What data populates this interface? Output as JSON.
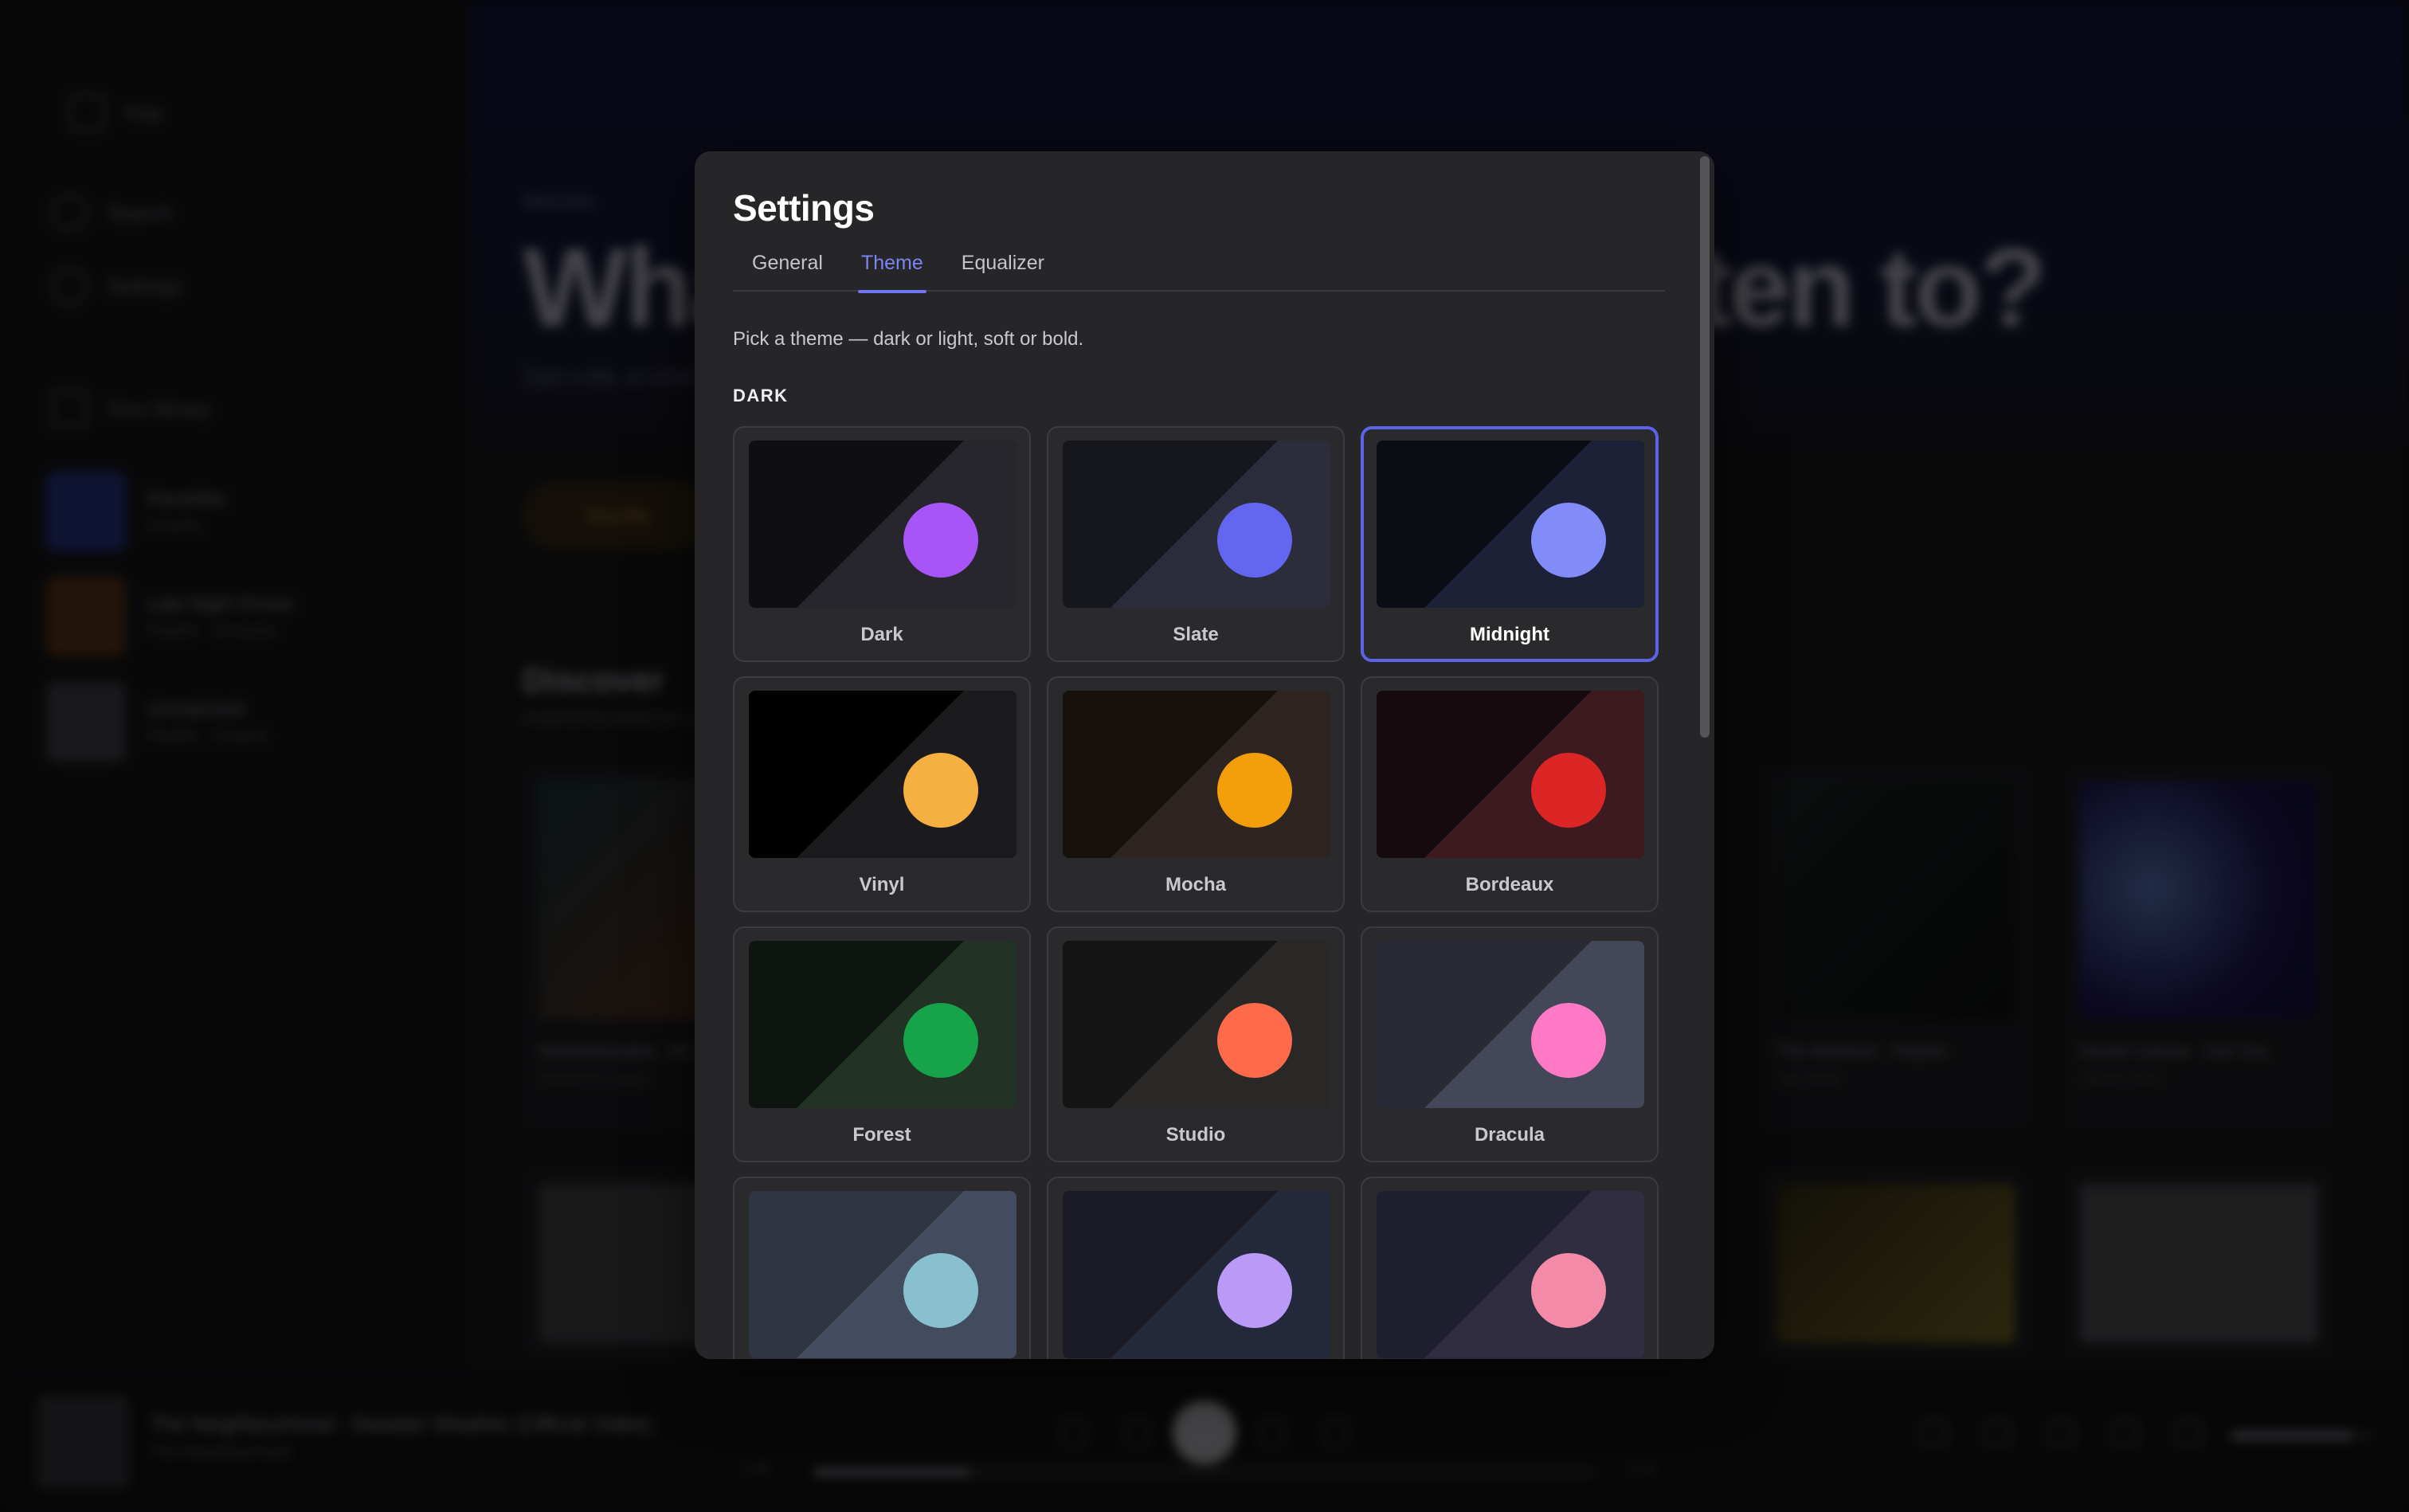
{
  "background": {
    "brand": "Hop",
    "nav": [
      "Search",
      "Settings"
    ],
    "library_label": "Your library",
    "library": [
      {
        "title": "Favorites",
        "sub": "0 tracks"
      },
      {
        "title": "Late Night Drives",
        "sub": "Playlist · 10 tracks"
      },
      {
        "title": "Unmatched",
        "sub": "Playlist · 2 tracks"
      }
    ],
    "hero": {
      "kicker": "Welcome",
      "title": "What do you want to listen to?",
      "sub": "Type a title, an artist or a mood"
    },
    "chip": "Shuffle",
    "discover": {
      "title": "Discover",
      "sub": "Inspired by what you play"
    },
    "cards": [
      {
        "title": "Needtobreathe · All The Rain",
        "sub": "Ranked by views"
      },
      {
        "title": "The Weeknd · Playlist",
        "sub": "Top tracks"
      },
      {
        "title": "Daniel Caesar · Get You",
        "sub": "Official Video"
      }
    ],
    "player": {
      "title": "The Neighbourhood - Sweater Weather (Official Video)",
      "artist": "The Neighbourhood",
      "elapsed": "1:20",
      "total": "4:12",
      "progress": 0.2,
      "volume": 0.85
    }
  },
  "modal": {
    "title": "Settings",
    "tabs": [
      {
        "label": "General",
        "active": false
      },
      {
        "label": "Theme",
        "active": true
      },
      {
        "label": "Equalizer",
        "active": false
      }
    ],
    "description": "Pick a theme — dark or light, soft or bold.",
    "section": "DARK",
    "themes": [
      {
        "name": "Dark",
        "bg": "#0f0f11",
        "panel": "#26262c",
        "accent": "#a855f7",
        "selected": false
      },
      {
        "name": "Slate",
        "bg": "#16171d",
        "panel": "#2b2e3a",
        "accent": "#6366f1",
        "selected": false
      },
      {
        "name": "Midnight",
        "bg": "#0a0d14",
        "panel": "#1d2138",
        "accent": "#818cf8",
        "selected": true
      },
      {
        "name": "Vinyl",
        "bg": "#000000",
        "panel": "#1b1b1d",
        "accent": "#f5b041",
        "selected": false
      },
      {
        "name": "Mocha",
        "bg": "#16110d",
        "panel": "#2e2522",
        "accent": "#f59e0b",
        "selected": false
      },
      {
        "name": "Bordeaux",
        "bg": "#150b0e",
        "panel": "#3d1a20",
        "accent": "#dc2626",
        "selected": false
      },
      {
        "name": "Forest",
        "bg": "#0e1511",
        "panel": "#223225",
        "accent": "#16a34a",
        "selected": false
      },
      {
        "name": "Studio",
        "bg": "#141414",
        "panel": "#2a2826",
        "accent": "#ff6b4a",
        "selected": false
      },
      {
        "name": "Dracula",
        "bg": "#282a36",
        "panel": "#444659",
        "accent": "#ff79c6",
        "selected": false
      },
      {
        "name": "",
        "bg": "#2e3440",
        "panel": "#434c5e",
        "accent": "#88c0d0",
        "selected": false
      },
      {
        "name": "",
        "bg": "#1a1b26",
        "panel": "#24283b",
        "accent": "#bb9af7",
        "selected": false
      },
      {
        "name": "",
        "bg": "#1e1e2e",
        "panel": "#302d41",
        "accent": "#f38ba8",
        "selected": false
      }
    ]
  }
}
